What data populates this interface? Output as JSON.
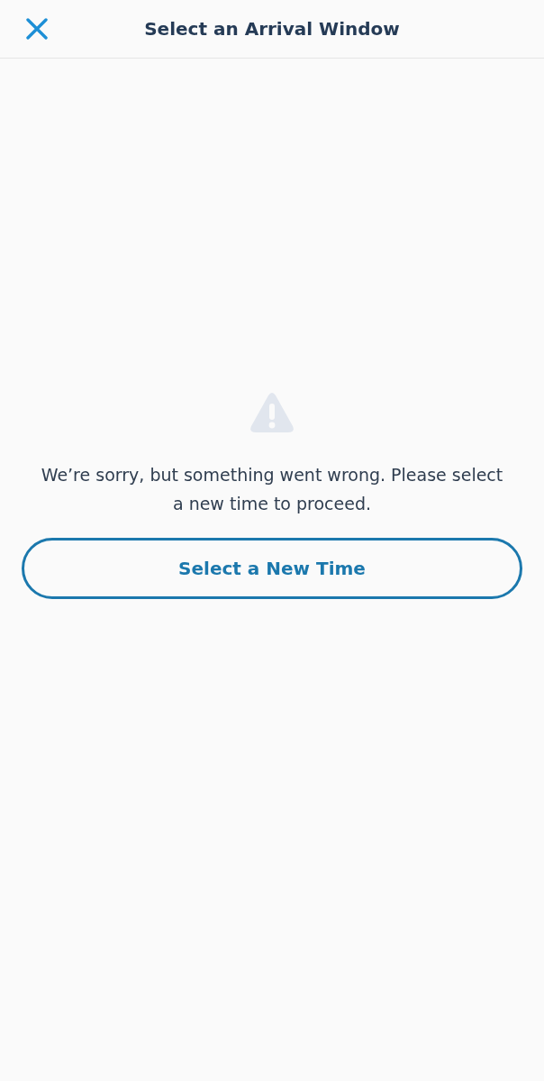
{
  "header": {
    "title": "Select an Arrival Window"
  },
  "error": {
    "message": "We’re sorry, but something went wrong. Please select a new time to proceed.",
    "button": "Select a New Time"
  }
}
